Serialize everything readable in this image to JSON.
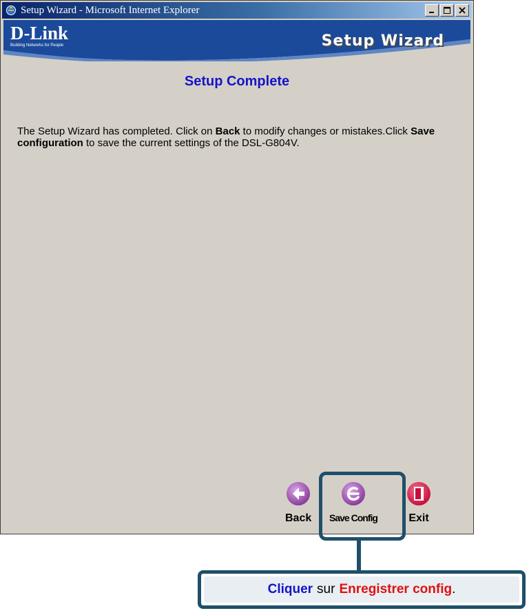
{
  "window": {
    "title": "Setup Wizard - Microsoft Internet Explorer"
  },
  "header": {
    "logo": "D-Link",
    "tagline": "Building Networks for People",
    "title": "Setup Wizard"
  },
  "main": {
    "page_title": "Setup Complete",
    "text_part1": "The Setup Wizard has completed. Click on ",
    "bold_back": "Back",
    "text_part2": " to modify changes or mistakes.Click ",
    "bold_save": "Save configuration",
    "text_part3": " to save the current settings of the DSL-G804V."
  },
  "nav": {
    "back_label": "Back",
    "save_label": "Save Config",
    "exit_label": "Exit"
  },
  "callout": {
    "verb": "Cliquer",
    "middle": "sur",
    "target": "Enregistrer config",
    "period": "."
  },
  "colors": {
    "title_blue": "#1414c8",
    "callout_red": "#e01010",
    "callout_border": "#1f4f6a",
    "header_band": "#1c4a9a",
    "nav_icon_purple": "#8a3c9a",
    "exit_icon_red": "#c80f3c"
  },
  "icons": {
    "back": "left-arrow-icon",
    "save": "ie-swirl-icon",
    "exit": "exit-door-icon"
  }
}
